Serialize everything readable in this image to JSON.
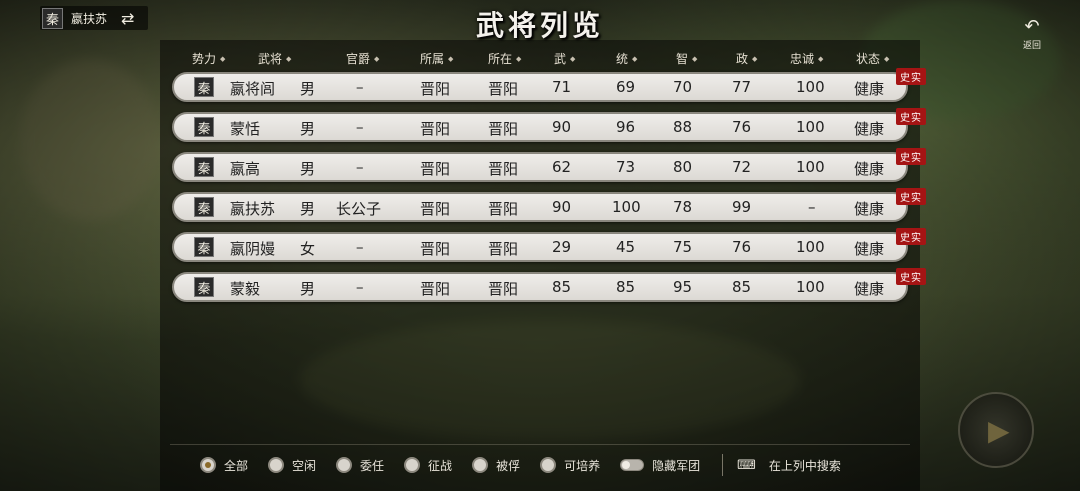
{
  "player": {
    "faction_seal": "秦",
    "name": "嬴扶苏",
    "swap_icon": "swap-arrows-icon"
  },
  "title": "武将列览",
  "back": {
    "label": "返回",
    "icon": "back-arrow-icon"
  },
  "columns": [
    "势力",
    "武将",
    "官爵",
    "所属",
    "所在",
    "武",
    "统",
    "智",
    "政",
    "忠诚",
    "状态"
  ],
  "rows": [
    {
      "faction": "秦",
      "name": "嬴将闾",
      "gender": "男",
      "rank": "–",
      "belong": "晋阳",
      "location": "晋阳",
      "wu": "71",
      "tong": "69",
      "zhi": "70",
      "zheng": "77",
      "loyalty": "100",
      "status": "健康",
      "badge": "史实"
    },
    {
      "faction": "秦",
      "name": "蒙恬",
      "gender": "男",
      "rank": "–",
      "belong": "晋阳",
      "location": "晋阳",
      "wu": "90",
      "tong": "96",
      "zhi": "88",
      "zheng": "76",
      "loyalty": "100",
      "status": "健康",
      "badge": "史实"
    },
    {
      "faction": "秦",
      "name": "嬴高",
      "gender": "男",
      "rank": "–",
      "belong": "晋阳",
      "location": "晋阳",
      "wu": "62",
      "tong": "73",
      "zhi": "80",
      "zheng": "72",
      "loyalty": "100",
      "status": "健康",
      "badge": "史实"
    },
    {
      "faction": "秦",
      "name": "嬴扶苏",
      "gender": "男",
      "rank": "长公子",
      "belong": "晋阳",
      "location": "晋阳",
      "wu": "90",
      "tong": "100",
      "zhi": "78",
      "zheng": "99",
      "loyalty": "–",
      "status": "健康",
      "badge": "史实"
    },
    {
      "faction": "秦",
      "name": "嬴阴嫚",
      "gender": "女",
      "rank": "–",
      "belong": "晋阳",
      "location": "晋阳",
      "wu": "29",
      "tong": "45",
      "zhi": "75",
      "zheng": "76",
      "loyalty": "100",
      "status": "健康",
      "badge": "史实"
    },
    {
      "faction": "秦",
      "name": "蒙毅",
      "gender": "男",
      "rank": "–",
      "belong": "晋阳",
      "location": "晋阳",
      "wu": "85",
      "tong": "85",
      "zhi": "95",
      "zheng": "85",
      "loyalty": "100",
      "status": "健康",
      "badge": "史实"
    }
  ],
  "filters": {
    "options": [
      {
        "label": "全部",
        "selected": true
      },
      {
        "label": "空闲",
        "selected": false
      },
      {
        "label": "委任",
        "selected": false
      },
      {
        "label": "征战",
        "selected": false
      },
      {
        "label": "被俘",
        "selected": false
      },
      {
        "label": "可培养",
        "selected": false
      }
    ],
    "hide_army_label": "隐藏军团",
    "hide_army_on": false,
    "search_label": "在上列中搜索",
    "search_icon": "keyboard-icon"
  },
  "colors": {
    "badge": "#a51414",
    "row_bg": "#e6e4e0",
    "text_light": "#e8e4da"
  }
}
